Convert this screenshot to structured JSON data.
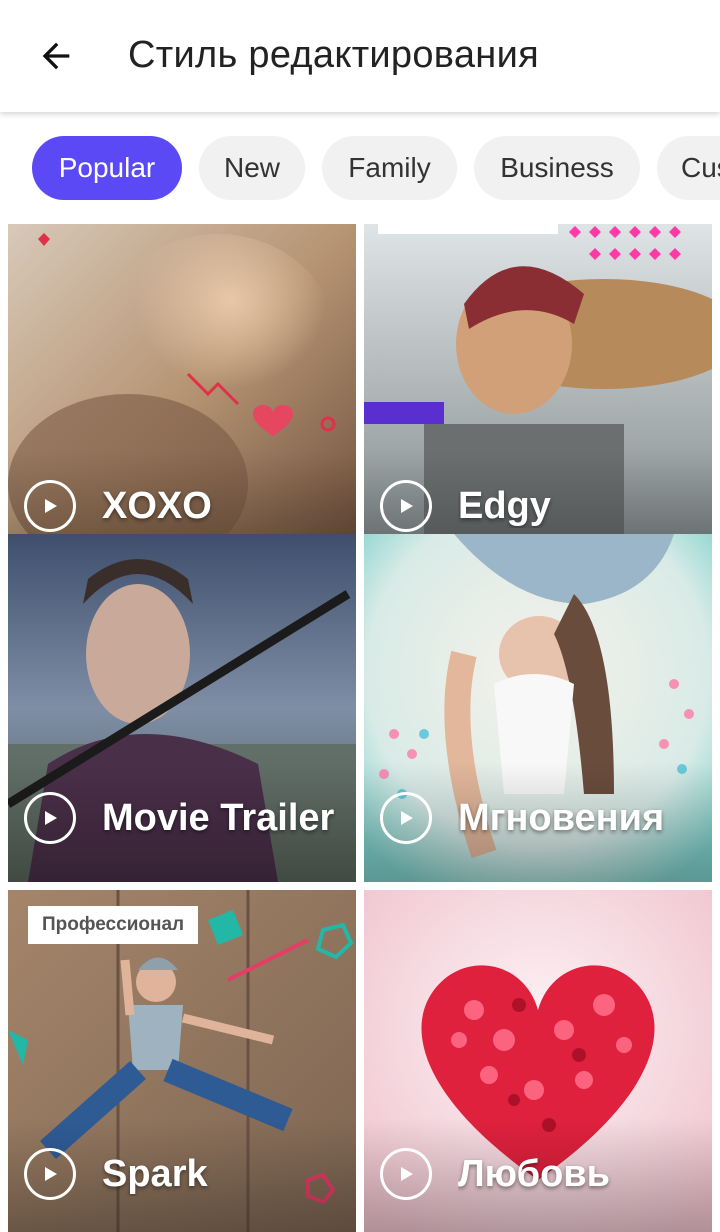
{
  "header": {
    "title": "Стиль редактирования"
  },
  "categories": [
    {
      "label": "Popular",
      "active": true
    },
    {
      "label": "New",
      "active": false
    },
    {
      "label": "Family",
      "active": false
    },
    {
      "label": "Business",
      "active": false
    },
    {
      "label": "Cus",
      "active": false
    }
  ],
  "styles": [
    {
      "label": "XOXO"
    },
    {
      "label": "Edgy"
    },
    {
      "label": "Movie Trailer"
    },
    {
      "label": "Мгновения"
    },
    {
      "label": "Spark",
      "badge": "Профессионал"
    },
    {
      "label": "Любовь"
    }
  ],
  "colors": {
    "accent": "#5b49f5",
    "chip_bg": "#f1f1f1",
    "title_text": "#222222"
  }
}
